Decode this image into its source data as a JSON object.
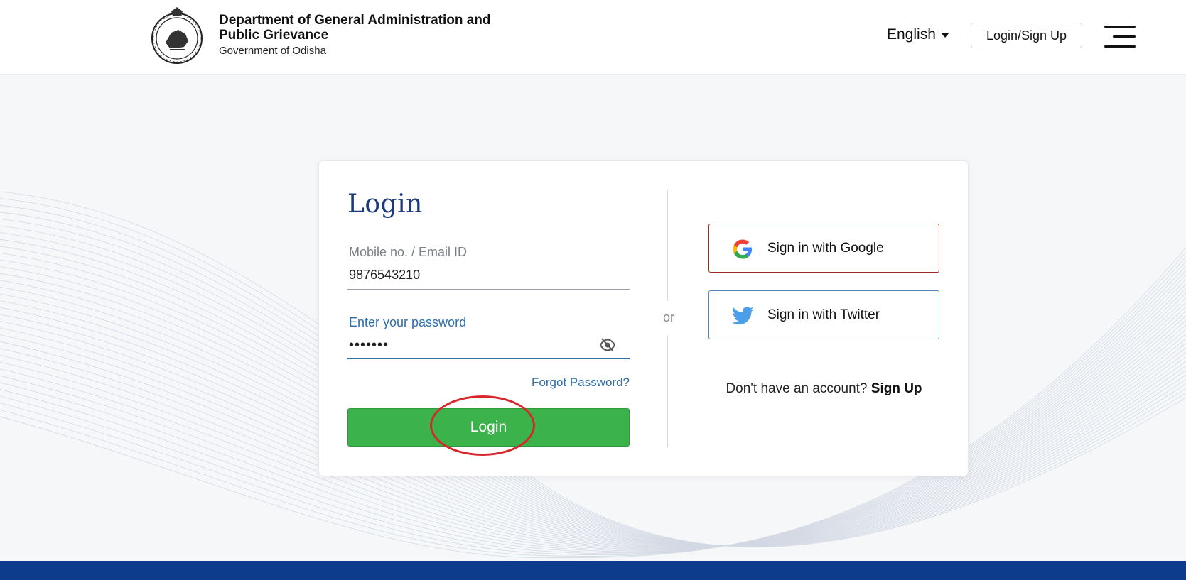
{
  "header": {
    "dept_title": "Department of General Administration and Public Grievance",
    "dept_subtitle": "Government of Odisha",
    "language": "English",
    "login_signup_label": "Login/Sign Up"
  },
  "login": {
    "title": "Login",
    "mobile_label": "Mobile no. / Email ID",
    "mobile_value": "9876543210",
    "password_label": "Enter your password",
    "password_value": "•••••••",
    "forgot_label": "Forgot Password?",
    "button_label": "Login"
  },
  "divider_text": "or",
  "social": {
    "google_label": "Sign in with Google",
    "twitter_label": "Sign in with Twitter"
  },
  "signup": {
    "prompt": "Don't have an account?",
    "link_label": "Sign Up"
  },
  "colors": {
    "accent_blue": "#1b3a7a",
    "login_green": "#3bb34a",
    "footer_blue": "#0e3c8c",
    "annotation_red": "#d8262a"
  },
  "icons": {
    "header_logo": "odisha-emblem-icon",
    "menu": "hamburger-menu-icon",
    "password_toggle": "eye-off-icon",
    "google": "google-icon",
    "twitter": "twitter-bird-icon"
  }
}
